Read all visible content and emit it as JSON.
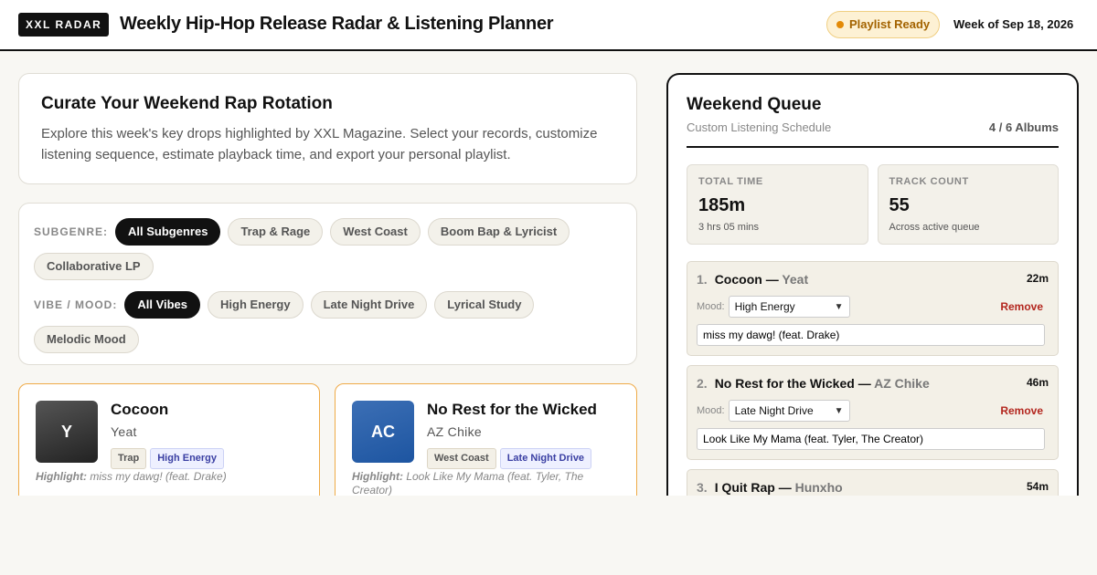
{
  "header": {
    "logo": "XXL RADAR",
    "title": "Weekly Hip-Hop Release Radar & Listening Planner",
    "badge": "Playlist Ready",
    "week": "Week of Sep 18, 2026"
  },
  "hero": {
    "title": "Curate Your Weekend Rap Rotation",
    "description": "Explore this week's key drops highlighted by XXL Magazine. Select your records, customize listening sequence, estimate playback time, and export your personal playlist."
  },
  "filters": {
    "subgenre_label": "SUBGENRE:",
    "subgenres": [
      "All Subgenres",
      "Trap & Rage",
      "West Coast",
      "Boom Bap & Lyricist",
      "Collaborative LP"
    ],
    "vibe_label": "VIBE / MOOD:",
    "vibes": [
      "All Vibes",
      "High Energy",
      "Late Night Drive",
      "Lyrical Study",
      "Melodic Mood"
    ]
  },
  "albums": [
    {
      "initials": "Y",
      "title": "Cocoon",
      "artist": "Yeat",
      "genre": "Trap",
      "mood": "High Energy",
      "highlight_label": "Highlight:",
      "highlight": "miss my dawg! (feat. Drake)"
    },
    {
      "initials": "AC",
      "title": "No Rest for the Wicked",
      "artist": "AZ Chike",
      "genre": "West Coast",
      "mood": "Late Night Drive",
      "highlight_label": "Highlight:",
      "highlight": "Look Like My Mama (feat. Tyler, The Creator)"
    }
  ],
  "queue": {
    "title": "Weekend Queue",
    "subtitle": "Custom Listening Schedule",
    "count": "4 / 6 Albums",
    "stats": [
      {
        "label": "TOTAL TIME",
        "value": "185m",
        "note": "3 hrs 05 mins"
      },
      {
        "label": "TRACK COUNT",
        "value": "55",
        "note": "Across active queue"
      }
    ],
    "mood_label": "Mood:",
    "remove_label": "Remove",
    "items": [
      {
        "num": "1.",
        "title": "Cocoon",
        "sep": "—",
        "artist": "Yeat",
        "duration": "22m",
        "mood": "High Energy",
        "track": "miss my dawg! (feat. Drake)"
      },
      {
        "num": "2.",
        "title": "No Rest for the Wicked",
        "sep": "—",
        "artist": "AZ Chike",
        "duration": "46m",
        "mood": "Late Night Drive",
        "track": "Look Like My Mama (feat. Tyler, The Creator)"
      },
      {
        "num": "3.",
        "title": "I Quit Rap",
        "sep": "—",
        "artist": "Hunxho",
        "duration": "54m"
      }
    ]
  }
}
